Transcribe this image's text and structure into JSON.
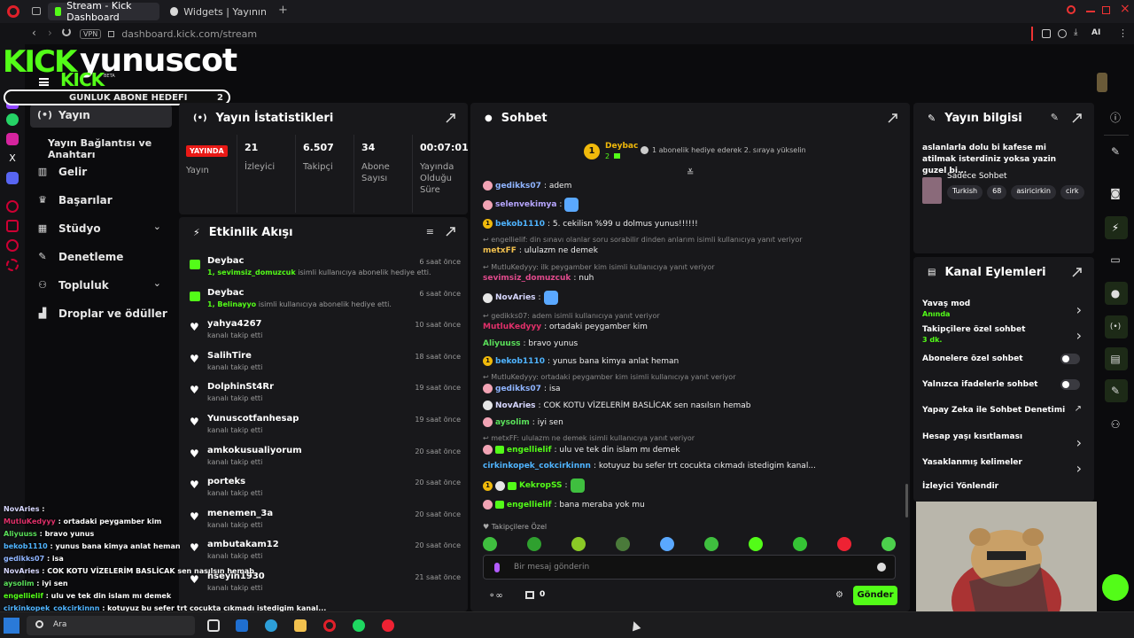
{
  "browser": {
    "tabs": [
      {
        "label": "Stream - Kick Dashboard"
      },
      {
        "label": "Widgets | Yayının güçlend"
      }
    ],
    "vpn_label": "VPN",
    "url": "dashboard.kick.com/stream",
    "ai_label": "AI"
  },
  "overlay": {
    "kick_logo": "KICK",
    "channel_name": "yunuscot",
    "kick_small": "KICK",
    "beta": "BETA",
    "goal_label": "GUNLUK ABONE HEDEFI",
    "goal_value": "2"
  },
  "nav": {
    "items": [
      {
        "label": "Yayın"
      },
      {
        "label": "Yayın Bağlantısı ve Anahtarı"
      },
      {
        "label": "Gelir"
      },
      {
        "label": "Başarılar"
      },
      {
        "label": "Stüdyo"
      },
      {
        "label": "Denetleme"
      },
      {
        "label": "Topluluk"
      },
      {
        "label": "Droplar ve ödüller"
      }
    ]
  },
  "stats": {
    "title": "Yayın İstatistikleri",
    "live_badge": "YAYINDA",
    "live_label": "Yayın",
    "items": [
      {
        "value": "21",
        "label": "İzleyici"
      },
      {
        "value": "6.507",
        "label": "Takipçi"
      },
      {
        "value": "34",
        "label": "Abone Sayısı"
      },
      {
        "value": "00:07:01",
        "label": "Yayında Olduğu Süre"
      }
    ]
  },
  "activity": {
    "title": "Etkinlik Akışı",
    "items": [
      {
        "name": "Deybac",
        "desc_em": "1, sevimsiz_domuzcuk",
        "desc": " isimli kullanıcıya abonelik hediye etti.",
        "time": "6 saat önce",
        "icon": "gift-sub"
      },
      {
        "name": "Deybac",
        "desc_em": "1, Belinayyo",
        "desc": " isimli kullanıcıya abonelik hediye etti.",
        "time": "6 saat önce",
        "icon": "gift-sub"
      },
      {
        "name": "yahya4267",
        "desc_em": "",
        "desc": "kanalı takip etti",
        "time": "10 saat önce",
        "icon": "heart"
      },
      {
        "name": "SalihTire",
        "desc_em": "",
        "desc": "kanalı takip etti",
        "time": "18 saat önce",
        "icon": "heart"
      },
      {
        "name": "DolphinSt4Rr",
        "desc_em": "",
        "desc": "kanalı takip etti",
        "time": "19 saat önce",
        "icon": "heart"
      },
      {
        "name": "Yunuscotfanhesap",
        "desc_em": "",
        "desc": "kanalı takip etti",
        "time": "19 saat önce",
        "icon": "heart"
      },
      {
        "name": "amkokusualiyorum",
        "desc_em": "",
        "desc": "kanalı takip etti",
        "time": "20 saat önce",
        "icon": "heart"
      },
      {
        "name": "porteks",
        "desc_em": "",
        "desc": "kanalı takip etti",
        "time": "20 saat önce",
        "icon": "heart"
      },
      {
        "name": "menemen_3a",
        "desc_em": "",
        "desc": "kanalı takip etti",
        "time": "20 saat önce",
        "icon": "heart"
      },
      {
        "name": "ambutakam12",
        "desc_em": "",
        "desc": "kanalı takip etti",
        "time": "20 saat önce",
        "icon": "heart"
      },
      {
        "name": "hseyin1930",
        "desc_em": "",
        "desc": "kanalı takip etti",
        "time": "21 saat önce",
        "icon": "heart"
      }
    ]
  },
  "chat": {
    "title": "Sohbet",
    "pinned": {
      "user": "Deybac",
      "count": "2",
      "rank": "1",
      "text": "1 abonelik hediye ederek 2. sıraya yükselin"
    },
    "messages": [
      {
        "type": "msg",
        "user": "gedikks07",
        "color": "#8fb4ff",
        "badges": [
          "pig"
        ],
        "text": ": adem"
      },
      {
        "type": "msg",
        "user": "selenvekimya",
        "color": "#b7a6ff",
        "badges": [
          "pig"
        ],
        "text": ":",
        "emote": "#5aa8ff"
      },
      {
        "type": "msg",
        "user": "bekob1110",
        "color": "#4fb4ff",
        "badges": [
          "gold"
        ],
        "text": ": 5. cekilisn %99 u dolmus yunus!!!!!!"
      },
      {
        "type": "reply",
        "text": "engellielif: din sınavı olanlar soru sorabilir dinden anlarım isimli kullanıcıya yanıt veriyor"
      },
      {
        "type": "msg",
        "user": "metxFF",
        "color": "#f2c14e",
        "badges": [],
        "text": ": ululazm ne demek"
      },
      {
        "type": "reply",
        "text": "MutluKedyyy: ilk peygamber kim isimli kullanıcıya yanıt veriyor"
      },
      {
        "type": "msg",
        "user": "sevimsiz_domuzcuk",
        "color": "#e04a8c",
        "badges": [],
        "text": ": nuh"
      },
      {
        "type": "msg",
        "user": "NovAries",
        "color": "#d8d8ff",
        "badges": [
          "mod"
        ],
        "text": ":",
        "emote": "#5aa8ff"
      },
      {
        "type": "reply",
        "text": "gedikks07: adem isimli kullanıcıya yanıt veriyor"
      },
      {
        "type": "msg",
        "user": "MutluKedyyy",
        "color": "#e0306a",
        "badges": [],
        "text": ": ortadaki peygamber kim"
      },
      {
        "type": "msg",
        "user": "Aliyuuss",
        "color": "#5ae05a",
        "badges": [],
        "text": ": bravo yunus"
      },
      {
        "type": "msg",
        "user": "bekob1110",
        "color": "#4fb4ff",
        "badges": [
          "gold"
        ],
        "text": ": yunus bana kimya anlat heman"
      },
      {
        "type": "reply",
        "text": "MutluKedyyy: ortadaki peygamber kim isimli kullanıcıya yanıt veriyor"
      },
      {
        "type": "msg",
        "user": "gedikks07",
        "color": "#8fb4ff",
        "badges": [
          "pig"
        ],
        "text": ": isa"
      },
      {
        "type": "msg",
        "user": "NovAries",
        "color": "#d8d8ff",
        "badges": [
          "mod"
        ],
        "text": ": COK KOTU VİZELERİM BASLİCAK sen nasılsın hemab"
      },
      {
        "type": "msg",
        "user": "aysolim",
        "color": "#5ae05a",
        "badges": [
          "pig"
        ],
        "text": ": iyi sen"
      },
      {
        "type": "reply",
        "text": "metxFF: ululazm ne demek isimli kullanıcıya yanıt veriyor"
      },
      {
        "type": "msg",
        "user": "engellielif",
        "color": "#53fc18",
        "badges": [
          "pig",
          "sub"
        ],
        "text": ": ulu ve tek din islam mı demek"
      },
      {
        "type": "msg",
        "user": "cirkinkopek_cokcirkinnn",
        "color": "#4fb4ff",
        "badges": [],
        "text": ": kotuyuz bu sefer trt cocukta cıkmadı istedigim kanal..."
      },
      {
        "type": "msg",
        "user": "KekropSS",
        "color": "#53fc18",
        "badges": [
          "gold",
          "mod",
          "sub"
        ],
        "text": ":",
        "emote": "#3fbf3f"
      },
      {
        "type": "msg",
        "user": "engellielif",
        "color": "#53fc18",
        "badges": [
          "pig",
          "sub"
        ],
        "text": ": bana meraba yok mu"
      }
    ],
    "followers_only_label": "Takipçilere Özel",
    "input_placeholder": "Bir mesaj gönderin",
    "points": "0",
    "send_label": "Gönder"
  },
  "stream_info": {
    "title": "Yayın bilgisi",
    "stream_title": "aslanlarla dolu bi kafese mi atilmak isterdiniz yoksa yazin guzel bi...",
    "category": "Sadece Sohbet",
    "tags": [
      "Turkish",
      "68",
      "asiricirkin",
      "cirk"
    ]
  },
  "channel_actions": {
    "title": "Kanal Eylemleri",
    "rows": [
      {
        "label": "Yavaş mod",
        "sub": "Anında",
        "control": "arrow"
      },
      {
        "label": "Takipçilere özel sohbet",
        "sub": "3 dk.",
        "control": "arrow"
      },
      {
        "label": "Abonelere özel sohbet",
        "sub": "",
        "control": "toggle"
      },
      {
        "label": "Yalnızca ifadelerle sohbet",
        "sub": "",
        "control": "toggle"
      },
      {
        "label": "Yapay Zeka ile Sohbet Denetimi",
        "sub": "",
        "control": "external"
      },
      {
        "label": "Hesap yaşı kısıtlaması",
        "sub": "",
        "control": "arrow"
      },
      {
        "label": "Yasaklanmış kelimeler",
        "sub": "",
        "control": "arrow"
      },
      {
        "label": "İzleyici Yönlendir",
        "sub": "",
        "control": "none"
      }
    ]
  },
  "overlay_chat": [
    {
      "user": "NovAries",
      "color": "#d8d8ff",
      "text": " :"
    },
    {
      "user": "MutluKedyyy",
      "color": "#e0306a",
      "text": " : ortadaki peygamber kim"
    },
    {
      "user": "Aliyuuss",
      "color": "#5ae05a",
      "text": " : bravo yunus"
    },
    {
      "user": "bekob1110",
      "color": "#4fb4ff",
      "text": " : yunus bana kimya anlat heman"
    },
    {
      "user": "gedikks07",
      "color": "#8fb4ff",
      "text": " : isa"
    },
    {
      "user": "NovAries",
      "color": "#d8d8ff",
      "text": " : COK KOTU VİZELERİM BASLİCAK sen nasılsın hemab"
    },
    {
      "user": "aysolim",
      "color": "#5ae05a",
      "text": " : iyi sen"
    },
    {
      "user": "engellielif",
      "color": "#53fc18",
      "text": " : ulu ve tek din islam mı demek"
    },
    {
      "user": "cirkinkopek_cokcirkinnn",
      "color": "#4fb4ff",
      "text": " : kotuyuz bu sefer trt cocukta cıkmadı istedigim kanal..."
    },
    {
      "user": "KekropSS",
      "color": "#53fc18",
      "text": " :"
    },
    {
      "user": "engellielif",
      "color": "#53fc18",
      "text": " : bana meraba yok mu"
    }
  ],
  "taskbar": {
    "search_label": "Ara"
  },
  "colors": {
    "kick_green": "#53fc18",
    "panel_bg": "#18181b",
    "page_bg": "#0b0b0d",
    "live_red": "#e91916"
  }
}
